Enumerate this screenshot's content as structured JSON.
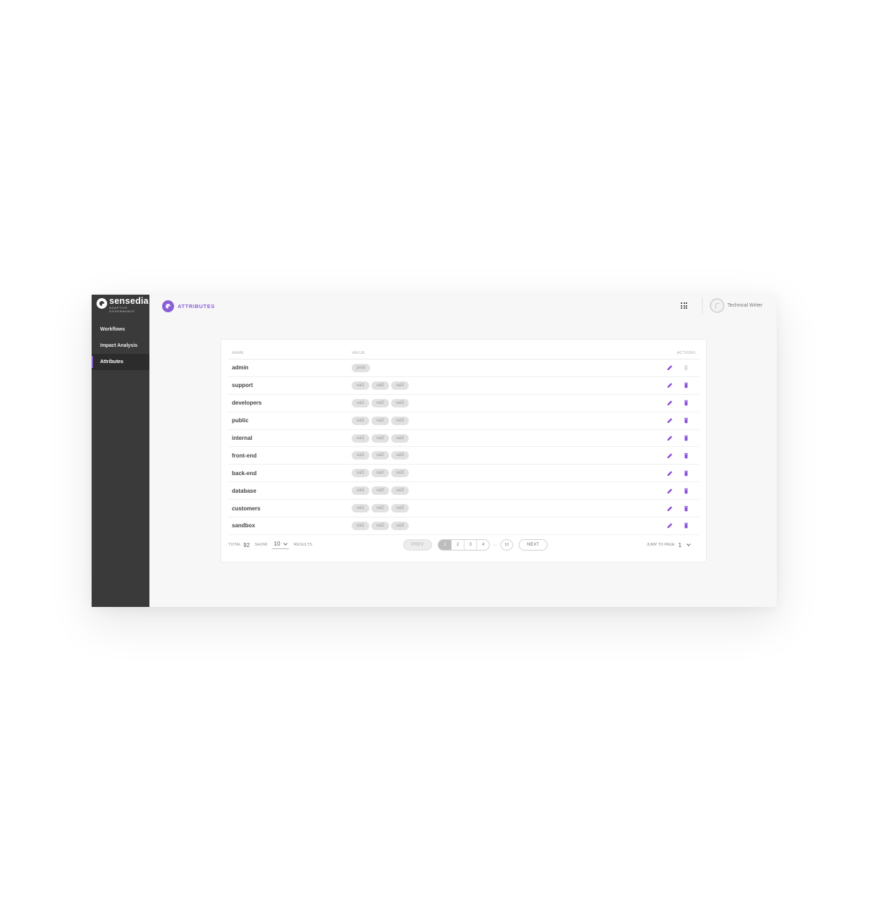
{
  "brand": {
    "name": "sensedia",
    "sub_line1": "ADAPTIVE",
    "sub_line2": "GOVERNANCE"
  },
  "sidebar": {
    "items": [
      {
        "label": "Workflows",
        "active": false
      },
      {
        "label": "Impact Analysis",
        "active": false
      },
      {
        "label": "Attributes",
        "active": true
      }
    ]
  },
  "header": {
    "title": "ATTRIBUTES",
    "user_name": "Technical Writer"
  },
  "table": {
    "columns": {
      "name": "NAME",
      "value": "VALUE",
      "actions": "ACTIONS"
    },
    "rows": [
      {
        "name": "admin",
        "values": [
          "prod"
        ],
        "delete_enabled": false
      },
      {
        "name": "support",
        "values": [
          "val1",
          "val2",
          "val3"
        ],
        "delete_enabled": true
      },
      {
        "name": "developers",
        "values": [
          "val1",
          "val2",
          "val3"
        ],
        "delete_enabled": true
      },
      {
        "name": "public",
        "values": [
          "val1",
          "val2",
          "val3"
        ],
        "delete_enabled": true
      },
      {
        "name": "internal",
        "values": [
          "val1",
          "val2",
          "val3"
        ],
        "delete_enabled": true
      },
      {
        "name": "front-end",
        "values": [
          "val1",
          "val2",
          "val3"
        ],
        "delete_enabled": true
      },
      {
        "name": "back-end",
        "values": [
          "val1",
          "val2",
          "val3"
        ],
        "delete_enabled": true
      },
      {
        "name": "database",
        "values": [
          "val1",
          "val2",
          "val3"
        ],
        "delete_enabled": true
      },
      {
        "name": "customers",
        "values": [
          "val1",
          "val2",
          "val3"
        ],
        "delete_enabled": true
      },
      {
        "name": "sandbox",
        "values": [
          "val1",
          "val2",
          "val3"
        ],
        "delete_enabled": true
      }
    ]
  },
  "pagination": {
    "total_label": "TOTAL",
    "total": "92",
    "show_label": "SHOW",
    "page_size": "10",
    "results_label": "RESULTS",
    "prev_label": "PREV",
    "next_label": "NEXT",
    "pages": [
      "1",
      "2",
      "3",
      "4"
    ],
    "current_page": "1",
    "ellipsis": "...",
    "last_page": "10",
    "jump_label": "JUMP TO PAGE",
    "jump_value": "1"
  },
  "fab": {
    "label": "+"
  },
  "colors": {
    "accent": "#8a4fd8",
    "sidebar_bg": "#3a3a3a",
    "chip_bg": "#e1e1e1"
  },
  "icons": {
    "edit": "pencil-icon",
    "delete": "trash-icon",
    "apps": "grid-icon",
    "chevron": "chevron-down-icon"
  }
}
